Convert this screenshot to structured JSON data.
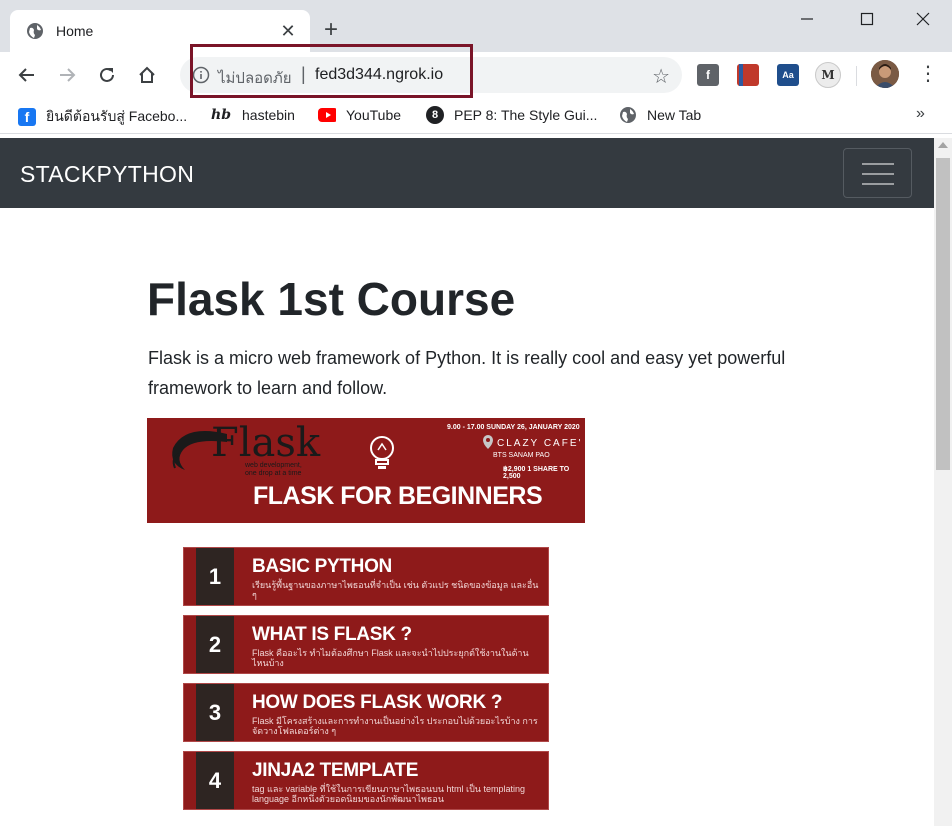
{
  "browser": {
    "tab": {
      "title": "Home",
      "close_icon": "close-icon"
    },
    "new_tab_symbol": "+",
    "address": {
      "insecure_label": "ไม่ปลอดภัย",
      "separator": "|",
      "url": "fed3d344.ngrok.io"
    },
    "extensions": [
      {
        "name": "facebook-ext-icon",
        "color": "#5f6368",
        "glyph": "f"
      },
      {
        "name": "red-book-ext-icon",
        "color": "#c0392b",
        "glyph": ""
      },
      {
        "name": "blue-dict-ext-icon",
        "color": "#1f4e8c",
        "glyph": "Aa"
      },
      {
        "name": "mendeley-ext-icon",
        "color": "#e0e0e0",
        "glyph": "M"
      }
    ],
    "bookmarks": [
      {
        "label": "ยินดีต้อนรับสู่ Facebo...",
        "icon": "facebook-icon"
      },
      {
        "label": "hastebin",
        "icon": "hastebin-icon",
        "glyph": "hb"
      },
      {
        "label": "YouTube",
        "icon": "youtube-icon"
      },
      {
        "label": "PEP 8: The Style Gui...",
        "icon": "pep8-icon",
        "glyph": "8"
      },
      {
        "label": "New Tab",
        "icon": "globe-icon"
      }
    ],
    "bookmarks_more": "»"
  },
  "page": {
    "navbar": {
      "brand": "STACKPYTHON"
    },
    "heading": "Flask 1st Course",
    "lead": "Flask is a micro web framework of Python. It is really cool and easy yet powerful framework to learn and follow.",
    "banner": {
      "logo": "Flask",
      "tagline_1": "web development,",
      "tagline_2": "one drop at a time",
      "title": "FLASK FOR BEGINNERS",
      "date": "9.00 - 17.00   SUNDAY 26, JANUARY 2020",
      "place": "CLAZY CAFE'",
      "bts": "BTS SANAM PAO",
      "price": "฿2,900   1 SHARE TO 2,500"
    },
    "lessons": [
      {
        "num": "1",
        "title": "BASIC PYTHON",
        "desc": "เรียนรู้พื้นฐานของภาษาไพธอนที่จำเป็น เช่น ตัวแปร ชนิดของข้อมูล และอื่น ๆ"
      },
      {
        "num": "2",
        "title": "WHAT IS FLASK ?",
        "desc": "Flask คืออะไร ทำไมต้องศึกษา Flask และจะนำไปประยุกต์ใช้งานในด้านไหนบ้าง"
      },
      {
        "num": "3",
        "title": "HOW DOES FLASK WORK ?",
        "desc": "Flask มีโครงสร้างและการทำงานเป็นอย่างไร ประกอบไปด้วยอะไรบ้าง การจัดวางโฟลเดอร์ต่าง ๆ"
      },
      {
        "num": "4",
        "title": "JINJA2 TEMPLATE",
        "desc": "tag และ variable ที่ใช้ในการเขียนภาษาไพธอนบน html เป็น templating language อีกหนึ่งตัวยอดนิยมของนักพัฒนาไพธอน"
      }
    ]
  }
}
